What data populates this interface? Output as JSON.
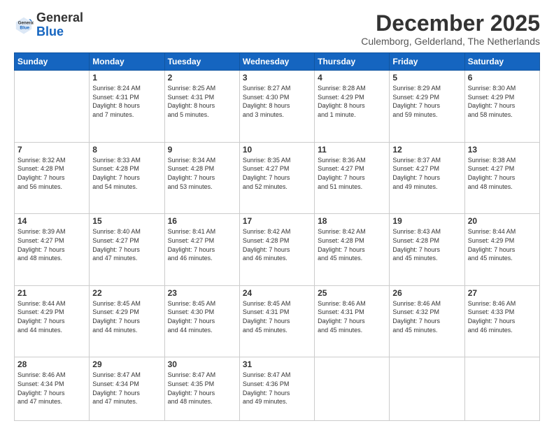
{
  "logo": {
    "general": "General",
    "blue": "Blue"
  },
  "header": {
    "month": "December 2025",
    "location": "Culemborg, Gelderland, The Netherlands"
  },
  "weekdays": [
    "Sunday",
    "Monday",
    "Tuesday",
    "Wednesday",
    "Thursday",
    "Friday",
    "Saturday"
  ],
  "weeks": [
    [
      {
        "day": "",
        "info": ""
      },
      {
        "day": "1",
        "info": "Sunrise: 8:24 AM\nSunset: 4:31 PM\nDaylight: 8 hours\nand 7 minutes."
      },
      {
        "day": "2",
        "info": "Sunrise: 8:25 AM\nSunset: 4:31 PM\nDaylight: 8 hours\nand 5 minutes."
      },
      {
        "day": "3",
        "info": "Sunrise: 8:27 AM\nSunset: 4:30 PM\nDaylight: 8 hours\nand 3 minutes."
      },
      {
        "day": "4",
        "info": "Sunrise: 8:28 AM\nSunset: 4:29 PM\nDaylight: 8 hours\nand 1 minute."
      },
      {
        "day": "5",
        "info": "Sunrise: 8:29 AM\nSunset: 4:29 PM\nDaylight: 7 hours\nand 59 minutes."
      },
      {
        "day": "6",
        "info": "Sunrise: 8:30 AM\nSunset: 4:29 PM\nDaylight: 7 hours\nand 58 minutes."
      }
    ],
    [
      {
        "day": "7",
        "info": "Sunrise: 8:32 AM\nSunset: 4:28 PM\nDaylight: 7 hours\nand 56 minutes."
      },
      {
        "day": "8",
        "info": "Sunrise: 8:33 AM\nSunset: 4:28 PM\nDaylight: 7 hours\nand 54 minutes."
      },
      {
        "day": "9",
        "info": "Sunrise: 8:34 AM\nSunset: 4:28 PM\nDaylight: 7 hours\nand 53 minutes."
      },
      {
        "day": "10",
        "info": "Sunrise: 8:35 AM\nSunset: 4:27 PM\nDaylight: 7 hours\nand 52 minutes."
      },
      {
        "day": "11",
        "info": "Sunrise: 8:36 AM\nSunset: 4:27 PM\nDaylight: 7 hours\nand 51 minutes."
      },
      {
        "day": "12",
        "info": "Sunrise: 8:37 AM\nSunset: 4:27 PM\nDaylight: 7 hours\nand 49 minutes."
      },
      {
        "day": "13",
        "info": "Sunrise: 8:38 AM\nSunset: 4:27 PM\nDaylight: 7 hours\nand 48 minutes."
      }
    ],
    [
      {
        "day": "14",
        "info": "Sunrise: 8:39 AM\nSunset: 4:27 PM\nDaylight: 7 hours\nand 48 minutes."
      },
      {
        "day": "15",
        "info": "Sunrise: 8:40 AM\nSunset: 4:27 PM\nDaylight: 7 hours\nand 47 minutes."
      },
      {
        "day": "16",
        "info": "Sunrise: 8:41 AM\nSunset: 4:27 PM\nDaylight: 7 hours\nand 46 minutes."
      },
      {
        "day": "17",
        "info": "Sunrise: 8:42 AM\nSunset: 4:28 PM\nDaylight: 7 hours\nand 46 minutes."
      },
      {
        "day": "18",
        "info": "Sunrise: 8:42 AM\nSunset: 4:28 PM\nDaylight: 7 hours\nand 45 minutes."
      },
      {
        "day": "19",
        "info": "Sunrise: 8:43 AM\nSunset: 4:28 PM\nDaylight: 7 hours\nand 45 minutes."
      },
      {
        "day": "20",
        "info": "Sunrise: 8:44 AM\nSunset: 4:29 PM\nDaylight: 7 hours\nand 45 minutes."
      }
    ],
    [
      {
        "day": "21",
        "info": "Sunrise: 8:44 AM\nSunset: 4:29 PM\nDaylight: 7 hours\nand 44 minutes."
      },
      {
        "day": "22",
        "info": "Sunrise: 8:45 AM\nSunset: 4:29 PM\nDaylight: 7 hours\nand 44 minutes."
      },
      {
        "day": "23",
        "info": "Sunrise: 8:45 AM\nSunset: 4:30 PM\nDaylight: 7 hours\nand 44 minutes."
      },
      {
        "day": "24",
        "info": "Sunrise: 8:45 AM\nSunset: 4:31 PM\nDaylight: 7 hours\nand 45 minutes."
      },
      {
        "day": "25",
        "info": "Sunrise: 8:46 AM\nSunset: 4:31 PM\nDaylight: 7 hours\nand 45 minutes."
      },
      {
        "day": "26",
        "info": "Sunrise: 8:46 AM\nSunset: 4:32 PM\nDaylight: 7 hours\nand 45 minutes."
      },
      {
        "day": "27",
        "info": "Sunrise: 8:46 AM\nSunset: 4:33 PM\nDaylight: 7 hours\nand 46 minutes."
      }
    ],
    [
      {
        "day": "28",
        "info": "Sunrise: 8:46 AM\nSunset: 4:34 PM\nDaylight: 7 hours\nand 47 minutes."
      },
      {
        "day": "29",
        "info": "Sunrise: 8:47 AM\nSunset: 4:34 PM\nDaylight: 7 hours\nand 47 minutes."
      },
      {
        "day": "30",
        "info": "Sunrise: 8:47 AM\nSunset: 4:35 PM\nDaylight: 7 hours\nand 48 minutes."
      },
      {
        "day": "31",
        "info": "Sunrise: 8:47 AM\nSunset: 4:36 PM\nDaylight: 7 hours\nand 49 minutes."
      },
      {
        "day": "",
        "info": ""
      },
      {
        "day": "",
        "info": ""
      },
      {
        "day": "",
        "info": ""
      }
    ]
  ]
}
